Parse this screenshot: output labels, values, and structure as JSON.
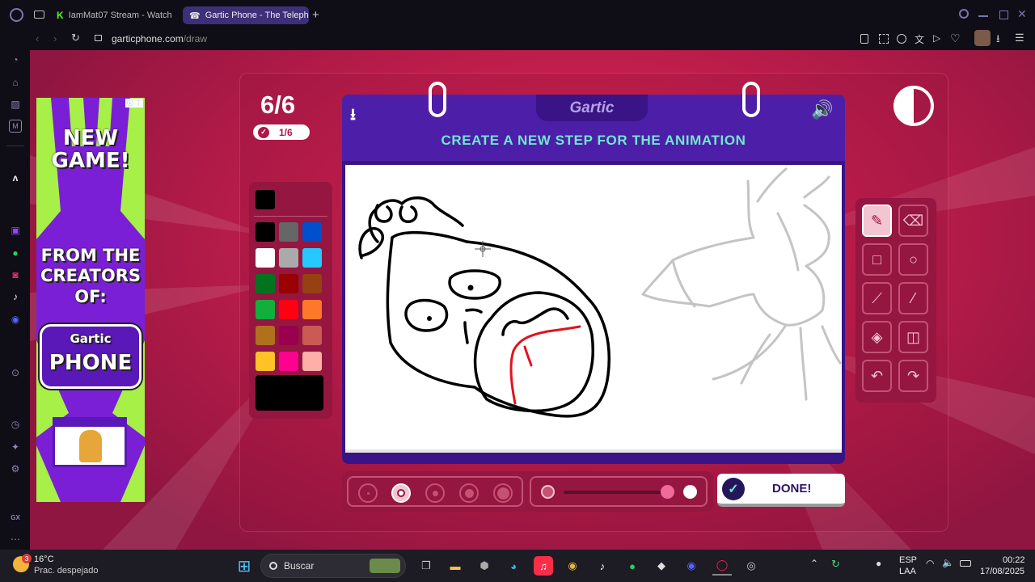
{
  "browser": {
    "tabs": [
      {
        "title": "IamMat07 Stream - Watch",
        "icon": "kick-icon"
      },
      {
        "title": "Gartic Phone - The Teleph",
        "icon": "phone-icon",
        "active": true
      }
    ],
    "url": {
      "domain": "garticphone.com",
      "path": "/draw"
    }
  },
  "ad": {
    "line1": "NEW",
    "line2": "GAME!",
    "line3": "FROM THE",
    "line4": "CREATORS",
    "line5": "OF:",
    "logo_top": "Gartic",
    "logo_bottom": "PHONE"
  },
  "game": {
    "round": "6/6",
    "progress": "1/6",
    "logo": "Gartic",
    "instruction": "CREATE A NEW STEP FOR THE ANIMATION",
    "done_label": "DONE!",
    "colors": {
      "selected": "#000000",
      "swatches": [
        "#000000",
        "#666666",
        "#0050cd",
        "#ffffff",
        "#aaaaaa",
        "#26c9ff",
        "#017420",
        "#990000",
        "#964112",
        "#11b03c",
        "#ff0013",
        "#ff7829",
        "#b0701c",
        "#99004e",
        "#cb5a57",
        "#ffc126",
        "#ff008f",
        "#feafa8"
      ]
    },
    "brush_sizes": [
      1,
      2,
      3,
      4,
      5
    ],
    "selected_brush_size": 2,
    "opacity_level": 0.85
  },
  "taskbar": {
    "weather": {
      "temp": "16°C",
      "desc": "Prac. despejado",
      "badge": "3"
    },
    "search_placeholder": "Buscar",
    "language": {
      "lang": "ESP",
      "layout": "LAA"
    },
    "time": "00:22",
    "date": "17/08/2025"
  }
}
